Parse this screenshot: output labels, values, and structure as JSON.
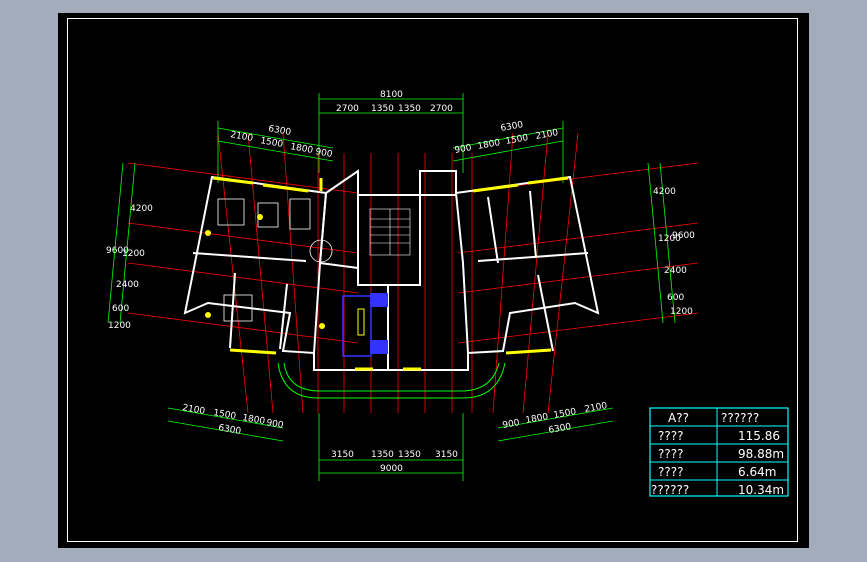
{
  "colors": {
    "background": "#000000",
    "dimension": "#00ff00",
    "axis": "#ff0000",
    "wall": "#ffffff",
    "window": "#ffff00",
    "table": "#00ffff",
    "furniture_blue": "#3333ff"
  },
  "dimensions": {
    "top_total": "8100",
    "top_parts": [
      "2700",
      "1350",
      "1350",
      "2700"
    ],
    "left_upper_total": "6300",
    "left_upper_parts": [
      "2100",
      "1500",
      "1800",
      "900"
    ],
    "right_upper_total": "6300",
    "right_upper_parts": [
      "900",
      "1800",
      "1500",
      "2100"
    ],
    "left_side": [
      "4200",
      "9600",
      "1200",
      "2400",
      "600",
      "1200"
    ],
    "right_side": [
      "4200",
      "1200",
      "9600",
      "2400",
      "600",
      "1200"
    ],
    "left_lower_parts": [
      "2100",
      "1500",
      "1800",
      "900"
    ],
    "left_lower_total": "6300",
    "right_lower_parts": [
      "900",
      "1800",
      "1500",
      "2100"
    ],
    "right_lower_total": "6300",
    "bottom_parts": [
      "3150",
      "1350",
      "1350",
      "3150"
    ],
    "bottom_total": "9000"
  },
  "table": {
    "header": [
      "A??",
      "??????"
    ],
    "rows": [
      [
        "????",
        "115.86"
      ],
      [
        "????",
        "98.88m"
      ],
      [
        "????",
        "6.64m"
      ],
      [
        "??????",
        "10.34m"
      ]
    ]
  }
}
